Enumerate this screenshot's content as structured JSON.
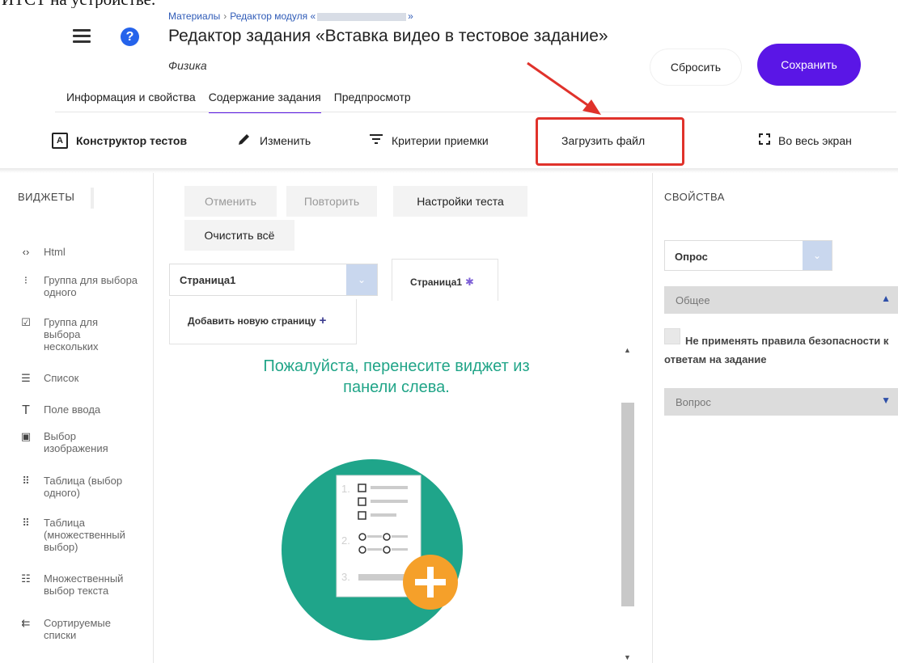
{
  "top_clip_text": "ИТСТ на устройстве.",
  "header": {
    "breadcrumb": [
      "Материалы",
      "Редактор модуля «",
      "»"
    ],
    "title": "Редактор задания «Вставка видео в тестовое задание»",
    "subtitle": "Физика",
    "reset_label": "Сбросить",
    "save_label": "Сохранить",
    "help_glyph": "?"
  },
  "tabs": [
    "Информация и свойства",
    "Содержание задания",
    "Предпросмотр"
  ],
  "toolbar": {
    "constructor_icon_text": "A",
    "constructor": "Конструктор тестов",
    "edit": "Изменить",
    "criteria": "Критерии приемки",
    "upload": "Загрузить файл",
    "fullscreen": "Во весь экран"
  },
  "widgets": {
    "title": "ВИДЖЕТЫ",
    "items": [
      {
        "icon": "html-icon",
        "glyph": "‹›",
        "label": "Html"
      },
      {
        "icon": "radio-group-icon",
        "glyph": "⁝",
        "label": "Группа для выбора одного"
      },
      {
        "icon": "checkbox-group-icon",
        "glyph": "☑",
        "label": "Группа для выбора нескольких"
      },
      {
        "icon": "dropdown-list-icon",
        "glyph": "☰",
        "label": "Список"
      },
      {
        "icon": "text-input-icon",
        "glyph": "T",
        "label": "Поле ввода"
      },
      {
        "icon": "image-picker-icon",
        "glyph": "▣",
        "label": "Выбор изображения"
      },
      {
        "icon": "matrix-single-icon",
        "glyph": "⠿",
        "label": "Таблица (выбор одного)"
      },
      {
        "icon": "matrix-multi-icon",
        "glyph": "⠿",
        "label": "Таблица (множественный выбор)"
      },
      {
        "icon": "multiple-text-icon",
        "glyph": "☷",
        "label": "Множественный выбор текста"
      },
      {
        "icon": "ranking-icon",
        "glyph": "⇇",
        "label": "Сортируемые списки"
      }
    ]
  },
  "editor": {
    "undo": "Отменить",
    "redo": "Повторить",
    "test_settings": "Настройки теста",
    "clear_all": "Очистить всё",
    "page_select_value": "Страница1",
    "page_tab": "Страница1",
    "add_page": "Добавить новую страницу",
    "drop_message": "Пожалуйста, перенесите виджет из панели слева.",
    "illustration_numbers": [
      "1.",
      "2.",
      "3."
    ]
  },
  "properties": {
    "title": "СВОЙСТВА",
    "select_value": "Опрос",
    "section_general": "Общее",
    "checkbox_label": "Не применять правила безопасности к ответам на задание",
    "section_question": "Вопрос"
  },
  "colors": {
    "accent": "#5a16e6",
    "highlight": "#e0322b",
    "illustration_circle": "#1fa58a",
    "add_badge": "#f5a02a",
    "drop_text": "#21a588"
  }
}
